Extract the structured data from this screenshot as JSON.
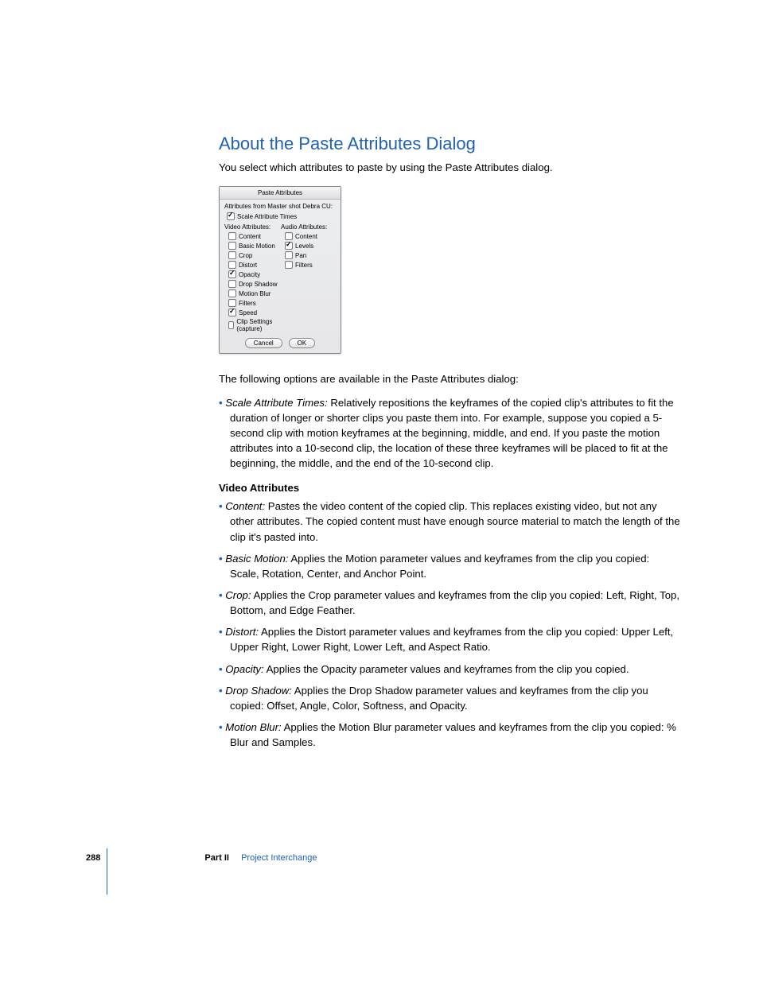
{
  "heading": "About the Paste Attributes Dialog",
  "intro": "You select which attributes to paste by using the Paste Attributes dialog.",
  "dialog": {
    "title": "Paste Attributes",
    "fromLine": "Attributes from Master shot Debra CU:",
    "scale": {
      "label": "Scale Attribute Times",
      "checked": true
    },
    "videoHeader": "Video Attributes:",
    "audioHeader": "Audio Attributes:",
    "video": [
      {
        "label": "Content",
        "checked": false
      },
      {
        "label": "Basic Motion",
        "checked": false
      },
      {
        "label": "Crop",
        "checked": false
      },
      {
        "label": "Distort",
        "checked": false
      },
      {
        "label": "Opacity",
        "checked": true
      },
      {
        "label": "Drop Shadow",
        "checked": false
      },
      {
        "label": "Motion Blur",
        "checked": false
      },
      {
        "label": "Filters",
        "checked": false
      },
      {
        "label": "Speed",
        "checked": true
      },
      {
        "label": "Clip Settings (capture)",
        "checked": false
      }
    ],
    "audio": [
      {
        "label": "Content",
        "checked": false
      },
      {
        "label": "Levels",
        "checked": true
      },
      {
        "label": "Pan",
        "checked": false
      },
      {
        "label": "Filters",
        "checked": false
      }
    ],
    "cancel": "Cancel",
    "ok": "OK"
  },
  "followingText": "The following options are available in the Paste Attributes dialog:",
  "topBullet": {
    "term": "Scale Attribute Times:",
    "text": "  Relatively repositions the keyframes of the copied clip's attributes to fit the duration of longer or shorter clips you paste them into. For example, suppose you copied a 5-second clip with motion keyframes at the beginning, middle, and end. If you paste the motion attributes into a 10-second clip, the location of these three keyframes will be placed to fit at the beginning, the middle, and the end of the 10-second clip."
  },
  "subhead": "Video Attributes",
  "vaBullets": [
    {
      "term": "Content:",
      "text": "  Pastes the video content of the copied clip. This replaces existing video, but not any other attributes. The copied content must have enough source material to match the length of the clip it's pasted into."
    },
    {
      "term": "Basic Motion:",
      "text": "  Applies the Motion parameter values and keyframes from the clip you copied:  Scale, Rotation, Center, and Anchor Point."
    },
    {
      "term": "Crop:",
      "text": "  Applies the Crop parameter values and keyframes from the clip you copied:  Left, Right, Top, Bottom, and Edge Feather."
    },
    {
      "term": "Distort:",
      "text": "  Applies the Distort parameter values and keyframes from the clip you copied:  Upper Left, Upper Right, Lower Right, Lower Left, and Aspect Ratio."
    },
    {
      "term": "Opacity:",
      "text": "  Applies the Opacity parameter values and keyframes from the clip you copied."
    },
    {
      "term": "Drop Shadow:",
      "text": "  Applies the Drop Shadow parameter values and keyframes from the clip you copied:  Offset, Angle, Color, Softness, and Opacity."
    },
    {
      "term": "Motion Blur:",
      "text": "  Applies the Motion Blur parameter values and keyframes from the clip you copied:  % Blur and Samples."
    }
  ],
  "footer": {
    "page": "288",
    "partLabel": "Part II",
    "chapter": "Project Interchange"
  }
}
